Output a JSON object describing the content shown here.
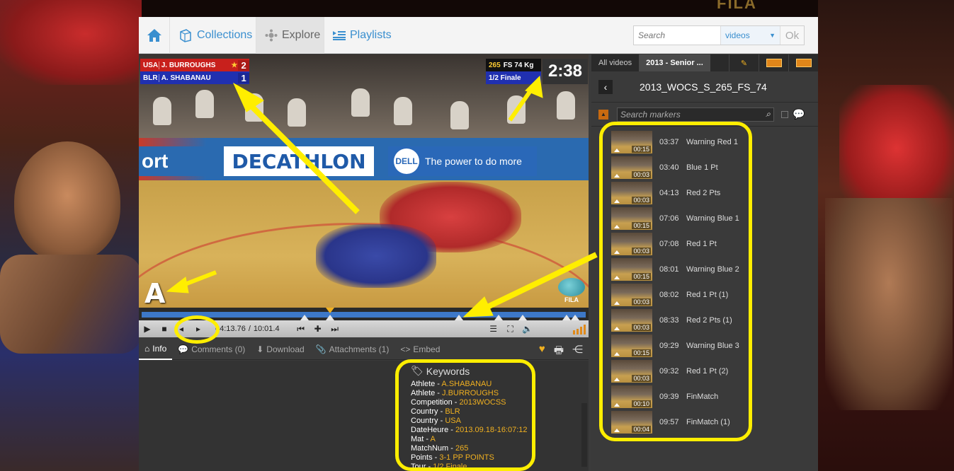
{
  "brand": {
    "top_logo": "FILA"
  },
  "nav": {
    "home_label": "",
    "collections": "Collections",
    "explore": "Explore",
    "playlists": "Playlists"
  },
  "search": {
    "placeholder": "Search",
    "scope": "videos",
    "ok": "Ok"
  },
  "video": {
    "scoreboard": {
      "red": {
        "country": "USA",
        "name": "J. BURROUGHS",
        "points": "2"
      },
      "blue": {
        "country": "BLR",
        "name": "A. SHABANAU",
        "points": "1"
      },
      "bout_number": "265",
      "weight_class": "FS 74 Kg",
      "round": "1/2 Finale",
      "clock": "2:38"
    },
    "mat_letter": "A",
    "fila_watermark": "FILA",
    "ads": {
      "left": "ort",
      "decathlon": "DECATHLON",
      "dell": "The power to do more",
      "dell_logo": "DELL"
    }
  },
  "controls": {
    "current_time": "04:13.76",
    "duration": "10:01.4",
    "separator": "/"
  },
  "tabs": [
    {
      "label": "Info",
      "active": true
    },
    {
      "label": "Comments (0)"
    },
    {
      "label": "Download"
    },
    {
      "label": "Attachments (1)"
    },
    {
      "label": "Embed"
    }
  ],
  "keywords": {
    "title": "Keywords",
    "items": [
      {
        "key": "Athlete",
        "value": "A.SHABANAU"
      },
      {
        "key": "Athlete",
        "value": "J.BURROUGHS"
      },
      {
        "key": "Competition",
        "value": "2013WOCSS"
      },
      {
        "key": "Country",
        "value": "BLR"
      },
      {
        "key": "Country",
        "value": "USA"
      },
      {
        "key": "DateHeure",
        "value": "2013.09.18-16:07:12"
      },
      {
        "key": "Mat",
        "value": "A"
      },
      {
        "key": "MatchNum",
        "value": "265"
      },
      {
        "key": "Points",
        "value": "3-1 PP  POINTS"
      },
      {
        "key": "Tour",
        "value": "1/2 Finale"
      }
    ]
  },
  "right_panel": {
    "tabs": [
      "All videos",
      "2013 - Senior ..."
    ],
    "title": "2013_WOCS_S_265_FS_74",
    "search_placeholder": "Search markers",
    "markers": [
      {
        "time": "03:37",
        "label": "Warning Red 1",
        "duration": "00:15"
      },
      {
        "time": "03:40",
        "label": "Blue 1 Pt",
        "duration": "00:03"
      },
      {
        "time": "04:13",
        "label": "Red 2 Pts",
        "duration": "00:03"
      },
      {
        "time": "07:06",
        "label": "Warning Blue 1",
        "duration": "00:15"
      },
      {
        "time": "07:08",
        "label": "Red 1 Pt",
        "duration": "00:03"
      },
      {
        "time": "08:01",
        "label": "Warning Blue 2",
        "duration": "00:15"
      },
      {
        "time": "08:02",
        "label": "Red 1 Pt (1)",
        "duration": "00:03"
      },
      {
        "time": "08:33",
        "label": "Red 2 Pts (1)",
        "duration": "00:03"
      },
      {
        "time": "09:29",
        "label": "Warning Blue 3",
        "duration": "00:15"
      },
      {
        "time": "09:32",
        "label": "Red 1 Pt (2)",
        "duration": "00:03"
      },
      {
        "time": "09:39",
        "label": "FinMatch",
        "duration": "00:10"
      },
      {
        "time": "09:57",
        "label": "FinMatch (1)",
        "duration": "00:04"
      }
    ]
  },
  "colors": {
    "accent": "#3a8fcf",
    "highlight": "#ffee00",
    "keyword_value": "#f0b020",
    "timeline": "#3d78c8"
  }
}
